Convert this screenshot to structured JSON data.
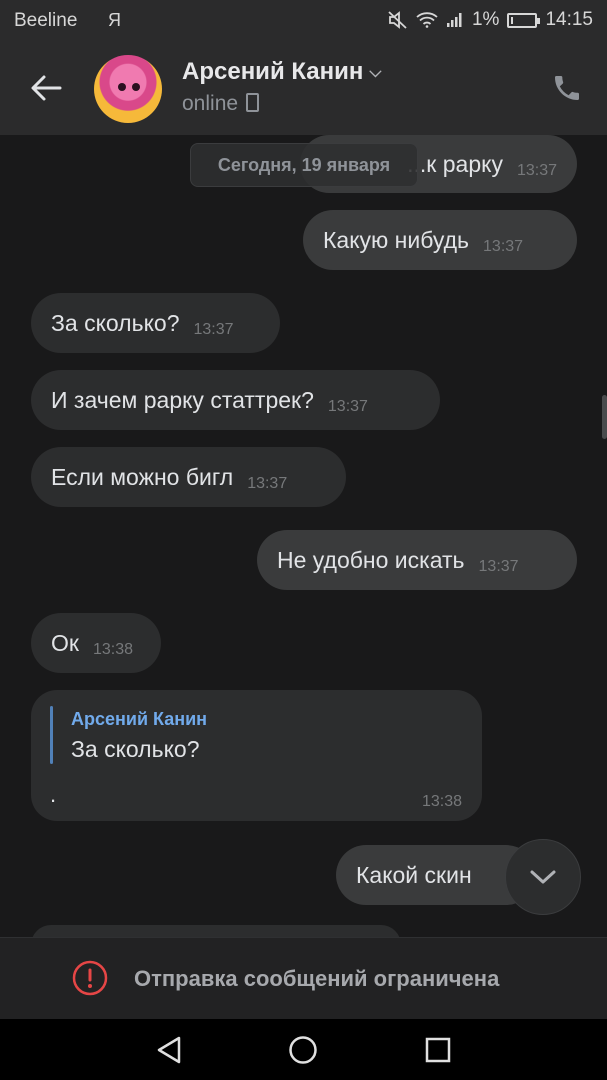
{
  "status_bar": {
    "carrier": "Beeline",
    "app_icon": "Я",
    "battery": "1%",
    "time": "14:15"
  },
  "header": {
    "name": "Арсений Канин",
    "status": "online"
  },
  "date_chip": "Сегодня, 19 января",
  "messages": [
    {
      "text": "...к рарку",
      "time": "13:37",
      "outgoing": true
    },
    {
      "text": "Какую нибудь",
      "time": "13:37",
      "outgoing": true
    },
    {
      "text": "За сколько?",
      "time": "13:37",
      "outgoing": false
    },
    {
      "text": "И зачем рарку статтрек?",
      "time": "13:37",
      "outgoing": false
    },
    {
      "text": "Если можно бигл",
      "time": "13:37",
      "outgoing": false
    },
    {
      "text": "Не удобно искать",
      "time": "13:37",
      "outgoing": true
    },
    {
      "text": "Ок",
      "time": "13:38",
      "outgoing": false
    }
  ],
  "reply_message": {
    "quoted_author": "Арсений Канин",
    "quoted_text": "За сколько?",
    "text": ".",
    "time": "13:38"
  },
  "last_message": {
    "text": "Какой скин",
    "outgoing": true
  },
  "restriction": {
    "text": "Отправка сообщений ограничена"
  },
  "colors": {
    "background": "#19191a",
    "accent": "#71aaeb",
    "warning": "#e64646"
  }
}
